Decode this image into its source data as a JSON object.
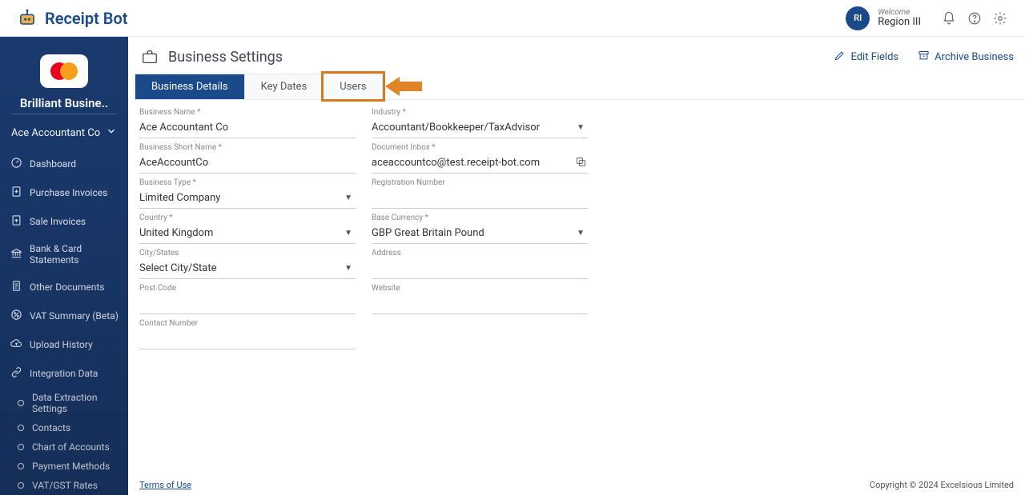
{
  "brand": {
    "name": "Receipt Bot",
    "avatar_initials": "RI"
  },
  "header": {
    "welcome": "Welcome",
    "user": "Region III"
  },
  "sidebar": {
    "business_display": "Brilliant Busine..",
    "account": "Ace Accountant Co",
    "nav": [
      {
        "label": "Dashboard"
      },
      {
        "label": "Purchase Invoices"
      },
      {
        "label": "Sale Invoices"
      },
      {
        "label": "Bank & Card Statements"
      },
      {
        "label": "Other Documents"
      },
      {
        "label": "VAT Summary (Beta)"
      },
      {
        "label": "Upload History"
      },
      {
        "label": "Integration Data"
      }
    ],
    "sub": [
      {
        "label": "Data Extraction Settings"
      },
      {
        "label": "Contacts"
      },
      {
        "label": "Chart of Accounts"
      },
      {
        "label": "Payment Methods"
      },
      {
        "label": "VAT/GST Rates"
      }
    ]
  },
  "page": {
    "title": "Business Settings",
    "actions": {
      "edit": "Edit Fields",
      "archive": "Archive Business"
    },
    "tabs": {
      "details": "Business Details",
      "keydates": "Key Dates",
      "users": "Users"
    }
  },
  "form": {
    "business_name": {
      "label": "Business Name *",
      "value": "Ace Accountant Co"
    },
    "industry": {
      "label": "Industry *",
      "value": "Accountant/Bookkeeper/TaxAdvisor"
    },
    "short_name": {
      "label": "Business Short Name *",
      "value": "AceAccountCo"
    },
    "doc_inbox": {
      "label": "Document Inbox *",
      "value": "aceaccountco@test.receipt-bot.com"
    },
    "business_type": {
      "label": "Business Type *",
      "value": "Limited Company"
    },
    "reg_number": {
      "label": "Registration Number",
      "value": ""
    },
    "country": {
      "label": "Country *",
      "value": "United Kingdom"
    },
    "base_currency": {
      "label": "Base Currency *",
      "value": "GBP Great Britain Pound"
    },
    "city": {
      "label": "City/States",
      "value": "Select City/State"
    },
    "address": {
      "label": "Address",
      "value": ""
    },
    "postcode": {
      "label": "Post Code",
      "value": ""
    },
    "website": {
      "label": "Website",
      "value": ""
    },
    "contact": {
      "label": "Contact Number",
      "value": ""
    }
  },
  "footer": {
    "terms": "Terms of Use",
    "copyright": "Copyright © 2024 Excelsious Limited"
  }
}
